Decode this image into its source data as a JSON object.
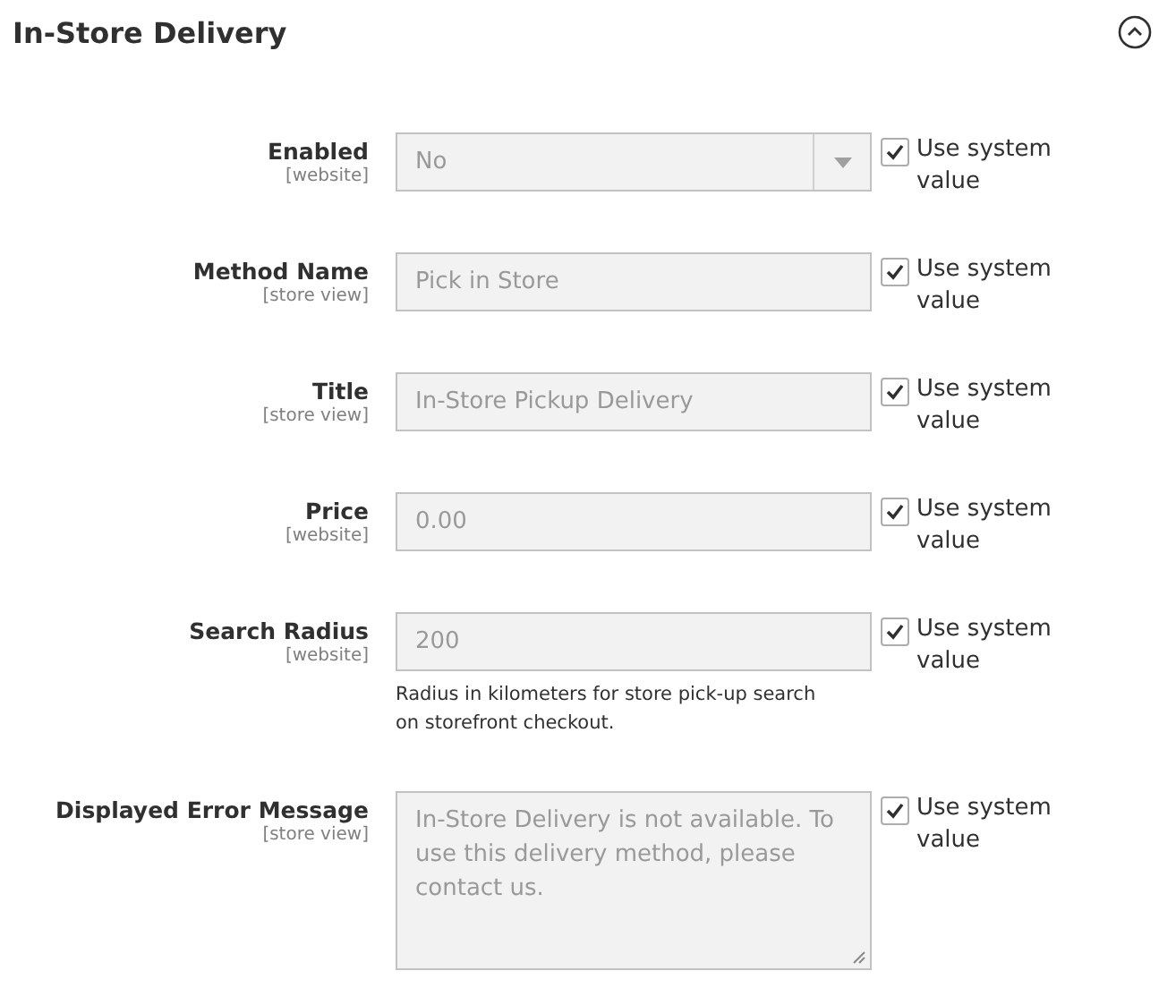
{
  "section": {
    "title": "In-Store Delivery",
    "expanded": true
  },
  "fields": [
    {
      "label": "Enabled",
      "scope": "[website]",
      "kind": "select",
      "value": "No",
      "use_system_label": "Use system value",
      "use_system": true
    },
    {
      "label": "Method Name",
      "scope": "[store view]",
      "kind": "input",
      "value": "Pick in Store",
      "use_system_label": "Use system value",
      "use_system": true
    },
    {
      "label": "Title",
      "scope": "[store view]",
      "kind": "input",
      "value": "In-Store Pickup Delivery",
      "use_system_label": "Use system value",
      "use_system": true
    },
    {
      "label": "Price",
      "scope": "[website]",
      "kind": "input",
      "value": "0.00",
      "use_system_label": "Use system value",
      "use_system": true
    },
    {
      "label": "Search Radius",
      "scope": "[website]",
      "kind": "input",
      "value": "200",
      "note": "Radius in kilometers for store pick-up search on storefront checkout.",
      "use_system_label": "Use system value",
      "use_system": true
    },
    {
      "label": "Displayed Error Message",
      "scope": "[store view]",
      "kind": "textarea",
      "value": "In-Store Delivery is not available. To use this delivery method, please contact us.",
      "use_system_label": "Use system value",
      "use_system": true
    }
  ]
}
